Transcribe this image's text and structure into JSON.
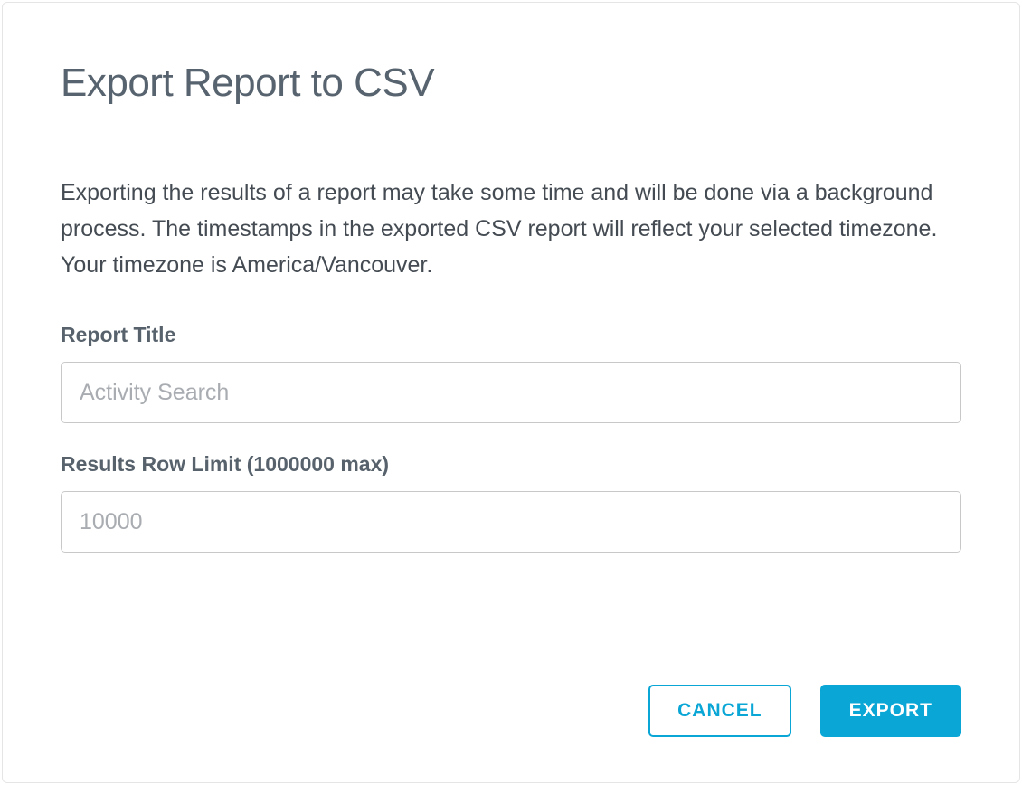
{
  "dialog": {
    "title": "Export Report to CSV",
    "description": "Exporting the results of a report may take some time and will be done via a background process. The timestamps in the exported CSV report will reflect your selected timezone. Your timezone is America/Vancouver.",
    "fields": {
      "report_title": {
        "label": "Report Title",
        "placeholder": "Activity Search",
        "value": ""
      },
      "row_limit": {
        "label": "Results Row Limit (1000000 max)",
        "placeholder": "10000",
        "value": ""
      }
    },
    "buttons": {
      "cancel": "CANCEL",
      "export": "EXPORT"
    }
  }
}
